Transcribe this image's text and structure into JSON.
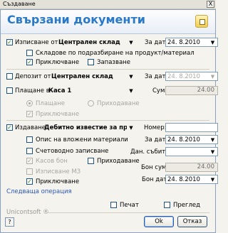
{
  "window": {
    "title": "Създаване",
    "close": "X"
  },
  "header": {
    "title": "Свързани документи",
    "icon": "document-icon"
  },
  "issue": {
    "checked": true,
    "label": "Изписване от",
    "warehouse": "Централен склад",
    "date_label": "За дата:",
    "date": "24. 8.2010",
    "default_warehouse": {
      "checked": false,
      "label": "Складове по подразбиране на продукт/материал"
    },
    "post": {
      "checked": true,
      "label": "Приключване"
    },
    "reserve": {
      "checked": false,
      "label": "Запазване"
    }
  },
  "deposit": {
    "checked": false,
    "label": "Депозит от",
    "warehouse": "Централен склад",
    "date_label": "За дата:",
    "date": "24. 8.2010"
  },
  "payment": {
    "checked": false,
    "label": "Плащане в",
    "account": "Каса 1",
    "sum_label": "Сума:",
    "sum": "24.00",
    "pay_radio": "Плащане",
    "income_radio": "Приходаване",
    "post_label": "Приключване"
  },
  "invoice": {
    "checked": true,
    "label": "Издаване",
    "doc_type": "Дебитно известие за продаж",
    "number_label": "Номер:",
    "number": "",
    "date_label": "За дата:",
    "date": "24. 8.2010",
    "event_label": "Дан. събитие:",
    "event_date": "",
    "materials": {
      "checked": false,
      "label": "Опис на вложени материали"
    },
    "accounting": {
      "checked": false,
      "label": "Счетоводно записване"
    },
    "cash": {
      "checked": true,
      "label": "Касов бон"
    },
    "income": {
      "checked": false,
      "label": "Приходаване"
    },
    "issue_m3": {
      "checked": false,
      "label": "Изписване МЗ"
    },
    "post": {
      "checked": true,
      "label": "Приключване"
    },
    "receipt_sum_label": "Бон сума:",
    "receipt_sum": "24.00",
    "receipt_date_label": "Бон дата:",
    "receipt_date": "24. 8.2010"
  },
  "next_link": "Следваща операция",
  "brand": "Unicontsoft ®",
  "print": {
    "checked": false,
    "label": "Печат"
  },
  "preview": {
    "checked": false,
    "label": "Преглед"
  },
  "buttons": {
    "ok": "Ok",
    "cancel": "Отказ"
  },
  "colors": {
    "header_text": "#2a79c8",
    "link": "#2a57b8",
    "check": "#0b8a11"
  }
}
